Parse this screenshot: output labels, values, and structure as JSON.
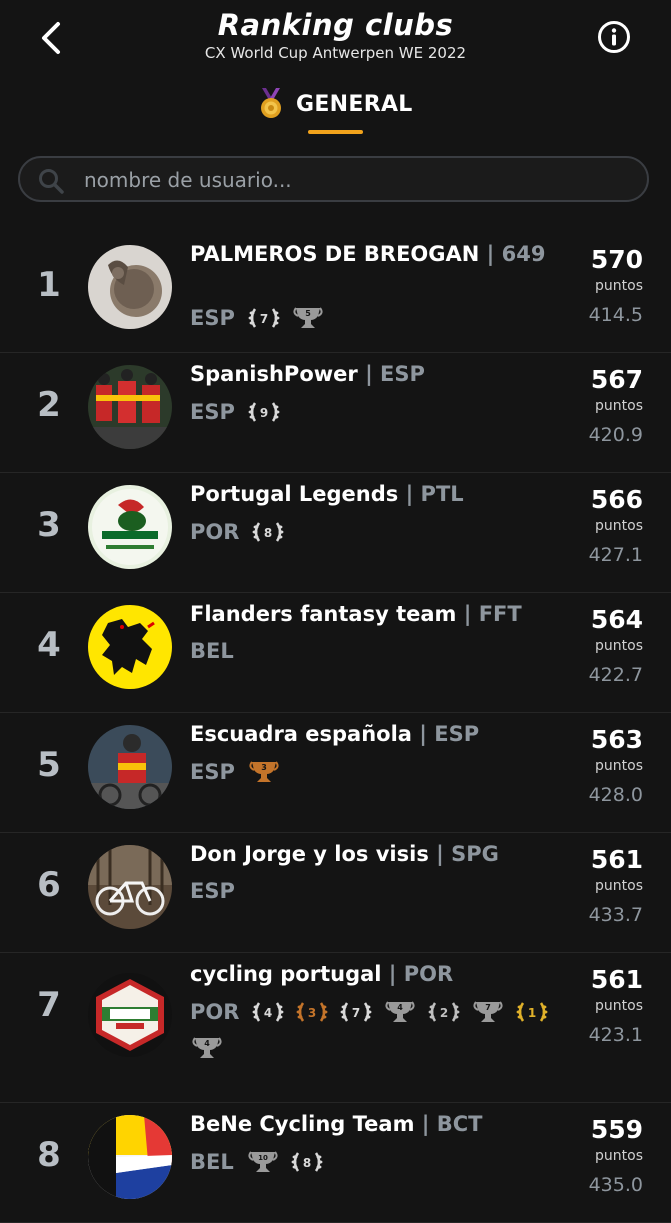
{
  "header": {
    "title": "Ranking clubs",
    "subtitle": "CX World Cup Antwerpen WE 2022",
    "back_icon": "chevron-left-icon",
    "info_icon": "info-circle-icon"
  },
  "tab": {
    "label": "GENERAL",
    "icon": "medal-icon",
    "accent": "#f2a31c"
  },
  "search": {
    "placeholder": "nombre de usuario...",
    "value": ""
  },
  "points_label": "puntos",
  "rows": [
    {
      "rank": "1",
      "name": "PALMEROS DE BREOGAN",
      "code": "| 649",
      "country": "ESP",
      "points": "570",
      "secondary": "414.5",
      "avatar": "stone-relief",
      "badges": [
        {
          "type": "laurel",
          "num": "7",
          "color": "#d9d9d9"
        },
        {
          "type": "trophy",
          "num": "5",
          "color": "#9a9a9a"
        }
      ]
    },
    {
      "rank": "2",
      "name": "SpanishPower",
      "code": "| ESP",
      "country": "ESP",
      "points": "567",
      "secondary": "420.9",
      "avatar": "cyclists-red",
      "badges": [
        {
          "type": "laurel",
          "num": "9",
          "color": "#d9d9d9"
        }
      ]
    },
    {
      "rank": "3",
      "name": "Portugal Legends",
      "code": "| PTL",
      "country": "POR",
      "points": "566",
      "secondary": "427.1",
      "avatar": "portugal-legends-logo",
      "badges": [
        {
          "type": "laurel",
          "num": "8",
          "color": "#d9d9d9"
        }
      ]
    },
    {
      "rank": "4",
      "name": "Flanders fantasy team",
      "code": "| FFT",
      "country": "BEL",
      "points": "564",
      "secondary": "422.7",
      "avatar": "flanders-lion",
      "badges": []
    },
    {
      "rank": "5",
      "name": "Escuadra española",
      "code": "| ESP",
      "country": "ESP",
      "points": "563",
      "secondary": "428.0",
      "avatar": "cyclist-spain",
      "badges": [
        {
          "type": "trophy",
          "num": "3",
          "color": "#c4742a"
        }
      ]
    },
    {
      "rank": "6",
      "name": "Don Jorge y los visis",
      "code": "| SPG",
      "country": "ESP",
      "points": "561",
      "secondary": "433.7",
      "avatar": "bicycle-photo",
      "badges": []
    },
    {
      "rank": "7",
      "name": "cycling portugal",
      "code": "| POR",
      "country": "POR",
      "points": "561",
      "secondary": "423.1",
      "avatar": "giro-italia-logo",
      "badges": [
        {
          "type": "laurel",
          "num": "4",
          "color": "#d9d9d9"
        },
        {
          "type": "laurel",
          "num": "3",
          "color": "#c4742a"
        },
        {
          "type": "laurel",
          "num": "7",
          "color": "#d9d9d9"
        },
        {
          "type": "trophy",
          "num": "4",
          "color": "#9a9a9a"
        },
        {
          "type": "laurel",
          "num": "2",
          "color": "#bfbfbf"
        },
        {
          "type": "trophy",
          "num": "7",
          "color": "#9a9a9a"
        },
        {
          "type": "laurel",
          "num": "1",
          "color": "#e0b12a"
        },
        {
          "type": "trophy",
          "num": "4",
          "color": "#9a9a9a"
        }
      ]
    },
    {
      "rank": "8",
      "name": "BeNe Cycling Team",
      "code": "| BCT",
      "country": "BEL",
      "points": "559",
      "secondary": "435.0",
      "avatar": "bene-flag",
      "badges": [
        {
          "type": "trophy",
          "num": "10",
          "color": "#9a9a9a"
        },
        {
          "type": "laurel",
          "num": "8",
          "color": "#d9d9d9"
        }
      ]
    }
  ]
}
